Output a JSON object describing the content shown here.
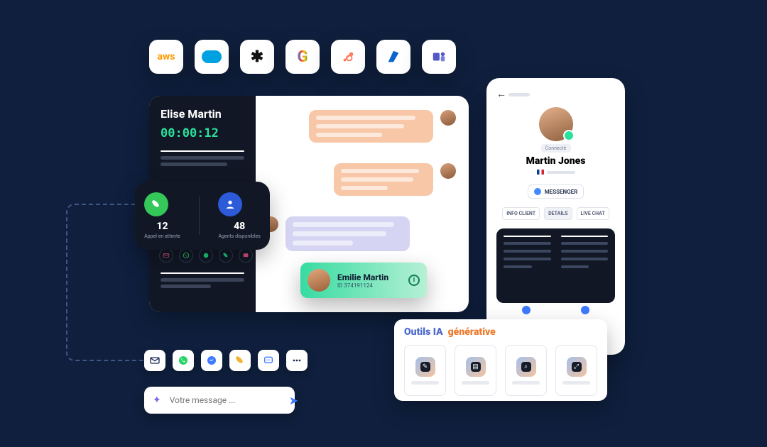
{
  "integrations": [
    "aws",
    "salesforce",
    "zendesk",
    "google",
    "hubspot",
    "azure",
    "ms-teams"
  ],
  "sidebar": {
    "caller": "Elise Martin",
    "timer": "00:00:12"
  },
  "call": {
    "queued": {
      "count": "12",
      "label": "Appel en attente"
    },
    "agents": {
      "count": "48",
      "label": "Agents disponibles"
    }
  },
  "channels": [
    "email",
    "whatsapp",
    "messenger",
    "phone",
    "sms"
  ],
  "contact": {
    "name": "Emilie Martin",
    "id": "ID 374191124"
  },
  "profile": {
    "status": "Connecté",
    "name": "Martin Jones",
    "channel": "MESSENGER",
    "tabs": [
      "INFO CLIENT",
      "DETAILS",
      "LIVE CHAT"
    ],
    "active_tab": 1
  },
  "ai": {
    "title_a": "Outils IA",
    "title_b": "générative",
    "tools": [
      "compose",
      "edit",
      "search",
      "expand"
    ]
  },
  "bottom_channels": [
    "email",
    "whatsapp",
    "messenger",
    "phone",
    "sms",
    "more"
  ],
  "input": {
    "placeholder": "Votre message ..."
  }
}
